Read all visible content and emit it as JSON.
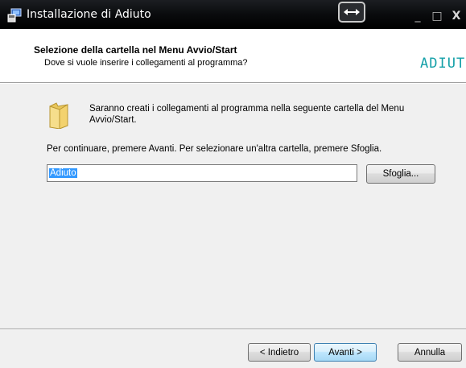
{
  "window": {
    "title": "Installazione di Adiuto",
    "minimize_glyph": "_",
    "maximize_glyph": "□",
    "close_glyph": "X"
  },
  "header": {
    "title": "Selezione della cartella nel Menu Avvio/Start",
    "subtitle": "Dove si vuole inserire i collegamenti al programma?",
    "logo_text": "ADIUT"
  },
  "body": {
    "info_text": "Saranno creati i collegamenti al programma nella seguente cartella del Menu Avvio/Start.",
    "instruction": "Per continuare, premere Avanti. Per selezionare un'altra cartella, premere Sfoglia.",
    "folder_value": "Adiuto",
    "browse_label": "Sfoglia..."
  },
  "footer": {
    "back_label": "< Indietro",
    "next_label": "Avanti >",
    "cancel_label": "Annulla"
  },
  "colors": {
    "titlebar": "#000000",
    "panel": "#f0f0f0",
    "selection": "#3399ff",
    "logo_teal": "#14a0a8"
  },
  "icons": {
    "app": "installer-icon",
    "folder": "folder-icon",
    "resize": "resize-arrows-icon"
  }
}
